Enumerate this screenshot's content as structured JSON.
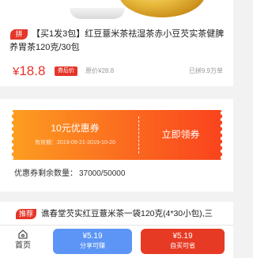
{
  "product": {
    "badge": "拼",
    "title": "【买1发3包】红豆薏米茶祛湿茶赤小豆芡实茶健脾养胃茶120克/30包",
    "currency": "¥",
    "price": "18.8",
    "after_coupon_label": "券后价",
    "original_price": "原价¥28.8",
    "sold": "已拼9.9万单"
  },
  "coupon": {
    "amount": "10元优惠券",
    "valid": "有效期：2019-09-21-2019-10-20",
    "claim_label": "立即领券",
    "remaining_label": "优惠券剩余数量：",
    "remaining_value": "37000/50000"
  },
  "recommend": {
    "badge": "推荐",
    "title": "谯春堂芡实红豆薏米茶一袋120克(4*30小包),三"
  },
  "bottom_bar": {
    "home_label": "首页",
    "share_price": "¥5.19",
    "share_label": "分享可赚",
    "buy_price": "¥5.19",
    "buy_label": "自买可省"
  },
  "colors": {
    "accent_red": "#e5362a",
    "share_blue": "#5c95f5",
    "coupon_orange": "#fb6a1f"
  }
}
